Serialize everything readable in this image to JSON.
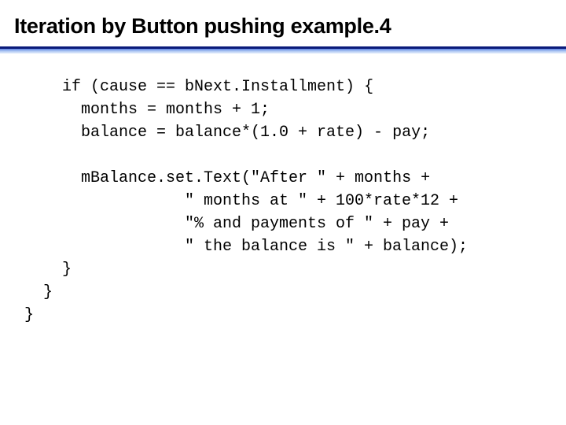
{
  "slide": {
    "title": "Iteration by Button pushing example.4",
    "accent_color": "#0a1a7a"
  },
  "code": {
    "lines": [
      "if (cause == bNext.Installment) {",
      "months = months + 1;",
      "balance = balance*(1.0 + rate) - pay;",
      "mBalance.set.Text(\"After \" + months +",
      "\" months at \" + 100*rate*12 +",
      "\"% and payments of \" + pay +",
      "\" the balance is \" + balance);",
      "}",
      "}",
      "}"
    ]
  }
}
